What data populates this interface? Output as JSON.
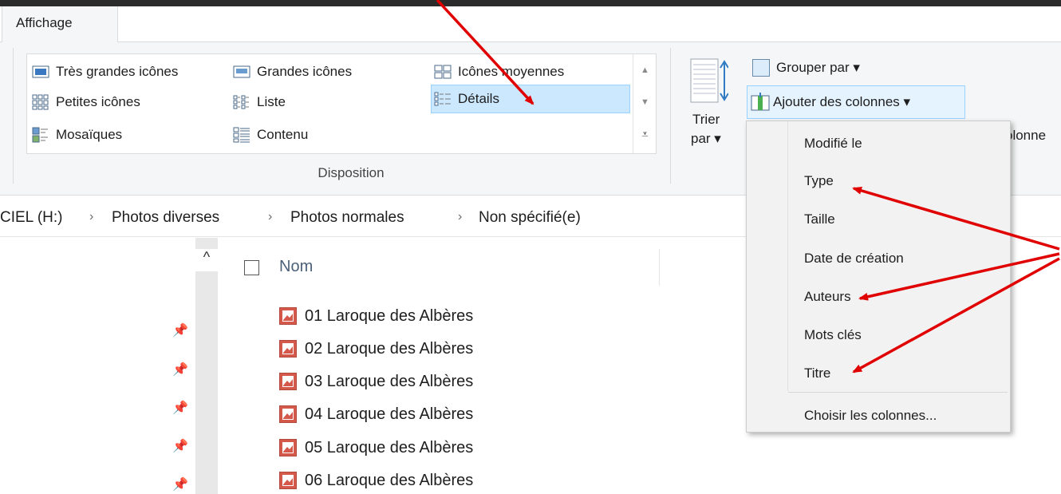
{
  "ribbon": {
    "tab_label": "Affichage",
    "layout": {
      "items": [
        {
          "label": "Très grandes icônes"
        },
        {
          "label": "Grandes icônes"
        },
        {
          "label": "Icônes moyennes"
        },
        {
          "label": "Petites icônes"
        },
        {
          "label": "Liste"
        },
        {
          "label": "Détails",
          "selected": true
        },
        {
          "label": "Mosaïques"
        },
        {
          "label": "Contenu"
        }
      ],
      "group_label": "Disposition"
    },
    "sort": {
      "label_line1": "Trier",
      "label_line2": "par ▾"
    },
    "group_by": "Grouper par ▾",
    "add_columns": "Ajouter des colonnes ▾",
    "columns_cut": "olonne"
  },
  "breadcrumb": [
    "CIEL (H:)",
    "Photos diverses",
    "Photos normales",
    "Non spécifié(e)"
  ],
  "file_list": {
    "header_name": "Nom",
    "files": [
      "01 Laroque des Albères",
      "02 Laroque des Albères",
      "03 Laroque des Albères",
      "04 Laroque des Albères",
      "05 Laroque des Albères",
      "06 Laroque des Albères"
    ]
  },
  "column_menu": {
    "items": [
      "Modifié le",
      "Type",
      "Taille",
      "Date de création",
      "Auteurs",
      "Mots clés",
      "Titre"
    ],
    "choose": "Choisir les colonnes..."
  },
  "colors": {
    "selection_bg": "#cce8ff",
    "selection_border": "#99d1ff",
    "annotation_arrow": "#e00000",
    "ribbon_bg": "#f5f6f7"
  }
}
